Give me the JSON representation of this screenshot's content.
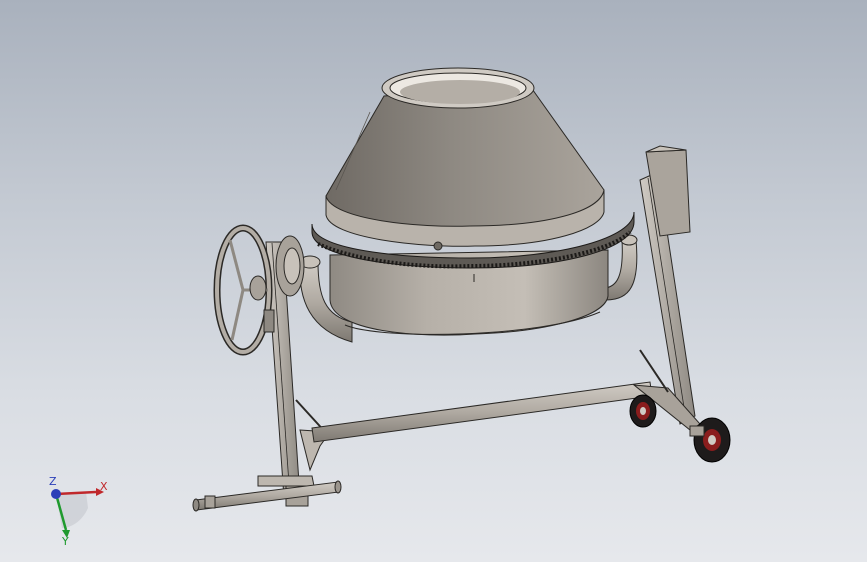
{
  "app": {
    "model": "concrete-mixer-3d-assembly"
  },
  "triad": {
    "x_label": "X",
    "y_label": "Y",
    "z_label": "Z",
    "x_color": "#c0282b",
    "y_color": "#1f9a2e",
    "z_color": "#2b3fb8"
  },
  "colors": {
    "metal_light": "#b9b3ab",
    "metal_mid": "#9c968e",
    "metal_dark": "#6e6962",
    "edge": "#2b2926",
    "wheel": "#1e1b1b",
    "wheel_red": "#8a1d1d"
  }
}
